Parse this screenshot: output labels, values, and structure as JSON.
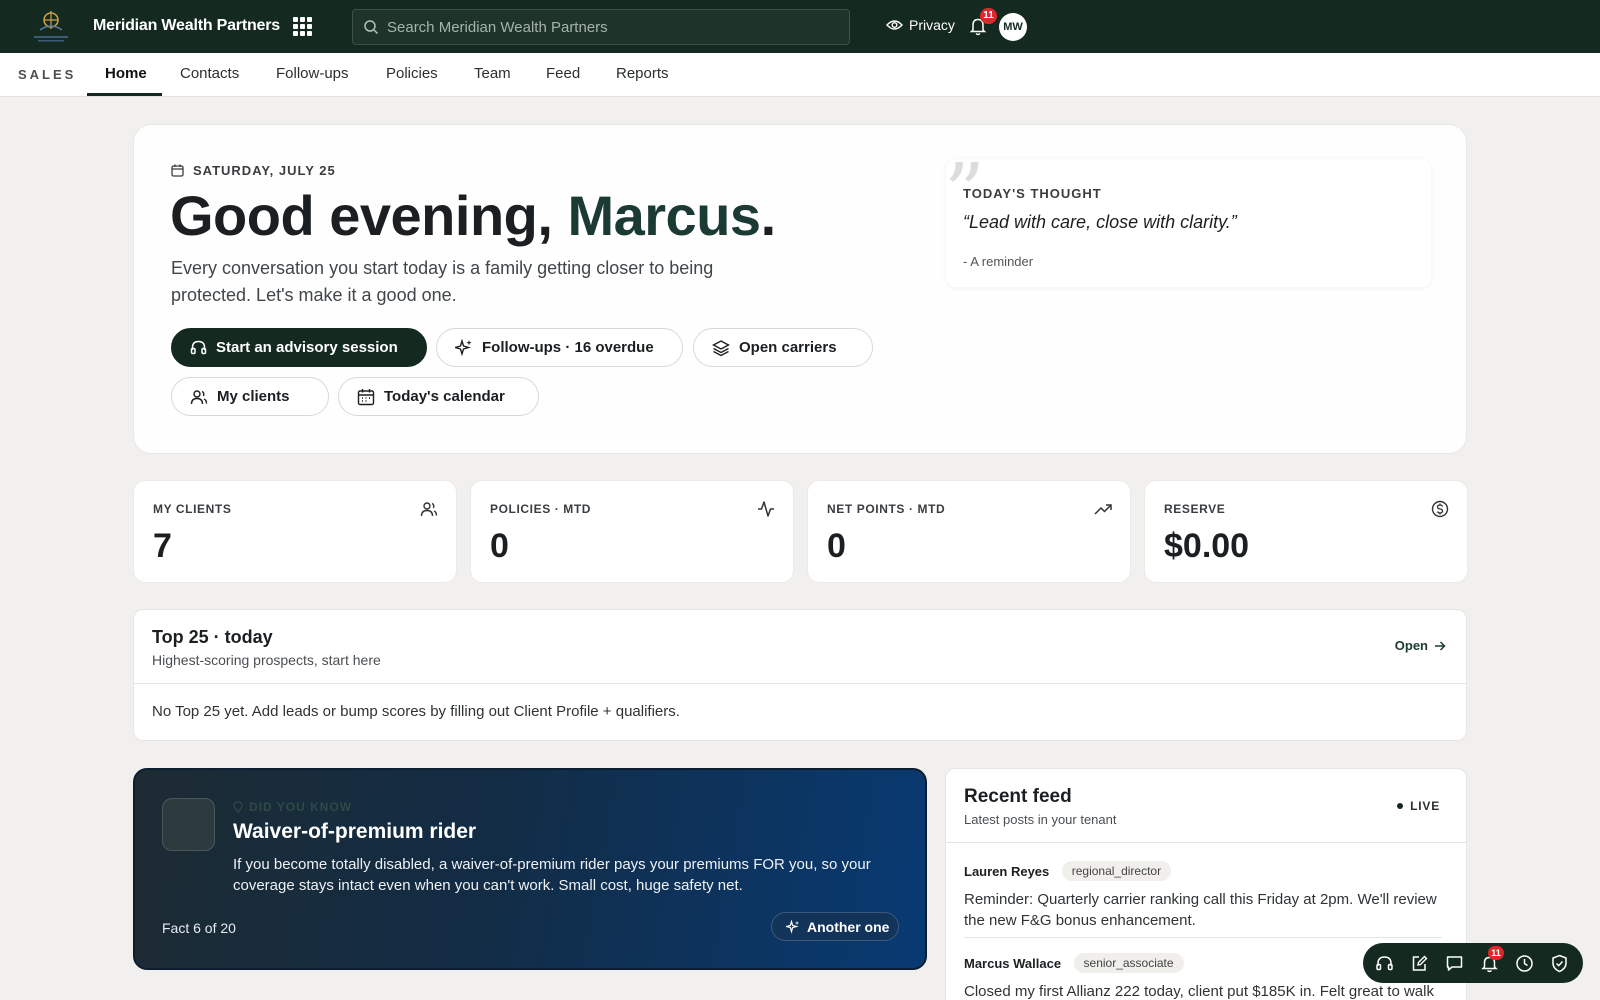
{
  "app": {
    "brand": "Meridian Wealth Partners",
    "search_placeholder": "Search Meridian Wealth Partners",
    "privacy_label": "Privacy",
    "notification_count": "11",
    "avatar_initials": "MW"
  },
  "subnav": {
    "section": "SALES",
    "tabs": [
      "Home",
      "Contacts",
      "Follow-ups",
      "Policies",
      "Team",
      "Feed",
      "Reports"
    ],
    "active_tab": "Home"
  },
  "hero": {
    "date": "SATURDAY, JULY 25",
    "greeting": "Good evening, ",
    "name": "Marcus",
    "greeting_end": ".",
    "lede": "Every conversation you start today is a family getting closer to being protected. Let's make it a good one.",
    "buttons": {
      "advisory": "Start an advisory session",
      "followups": "Follow-ups · 16 overdue",
      "carriers": "Open carriers",
      "clients": "My clients",
      "calendar": "Today's calendar"
    },
    "thought": {
      "label": "TODAY'S THOUGHT",
      "quote": "“Lead with care, close with clarity.”",
      "attribution": "- A reminder"
    }
  },
  "stats": [
    {
      "label": "MY CLIENTS",
      "value": "7",
      "icon": "users-icon"
    },
    {
      "label": "POLICIES · MTD",
      "value": "0",
      "icon": "activity-icon"
    },
    {
      "label": "NET POINTS · MTD",
      "value": "0",
      "icon": "trending-up-icon"
    },
    {
      "label": "RESERVE",
      "value": "$0.00",
      "icon": "dollar-circle-icon"
    }
  ],
  "top25": {
    "title": "Top 25 · today",
    "subtitle": "Highest-scoring prospects, start here",
    "open_label": "Open",
    "empty_text": "No Top 25 yet. Add leads or bump scores by filling out Client Profile + qualifiers."
  },
  "fact": {
    "eyebrow": "DID YOU KNOW",
    "title": "Waiver-of-premium rider",
    "body": "If you become totally disabled, a waiver-of-premium rider pays your premiums FOR you, so your coverage stays intact even when you can't work. Small cost, huge safety net.",
    "counter": "Fact 6 of 20",
    "another_label": "Another one"
  },
  "feed": {
    "title": "Recent feed",
    "subtitle": "Latest posts in your tenant",
    "live_label": "LIVE",
    "posts": [
      {
        "author": "Lauren Reyes",
        "role": "regional_director",
        "text": "Reminder: Quarterly carrier ranking call this Friday at 2pm. We'll review the new F&G bonus enhancement."
      },
      {
        "author": "Marcus Wallace",
        "role": "senior_associate",
        "text": "Closed my first Allianz 222 today, client put $185K in. Felt great to walk"
      }
    ]
  },
  "dock": {
    "notification_count": "11",
    "icons": [
      "headset-icon",
      "edit-icon",
      "chat-icon",
      "bell-icon",
      "clock-icon",
      "shield-check-icon"
    ]
  },
  "colors": {
    "brand_dark": "#14291f",
    "fact_gradient_end": "#083a73",
    "badge_red": "#e0262b"
  }
}
